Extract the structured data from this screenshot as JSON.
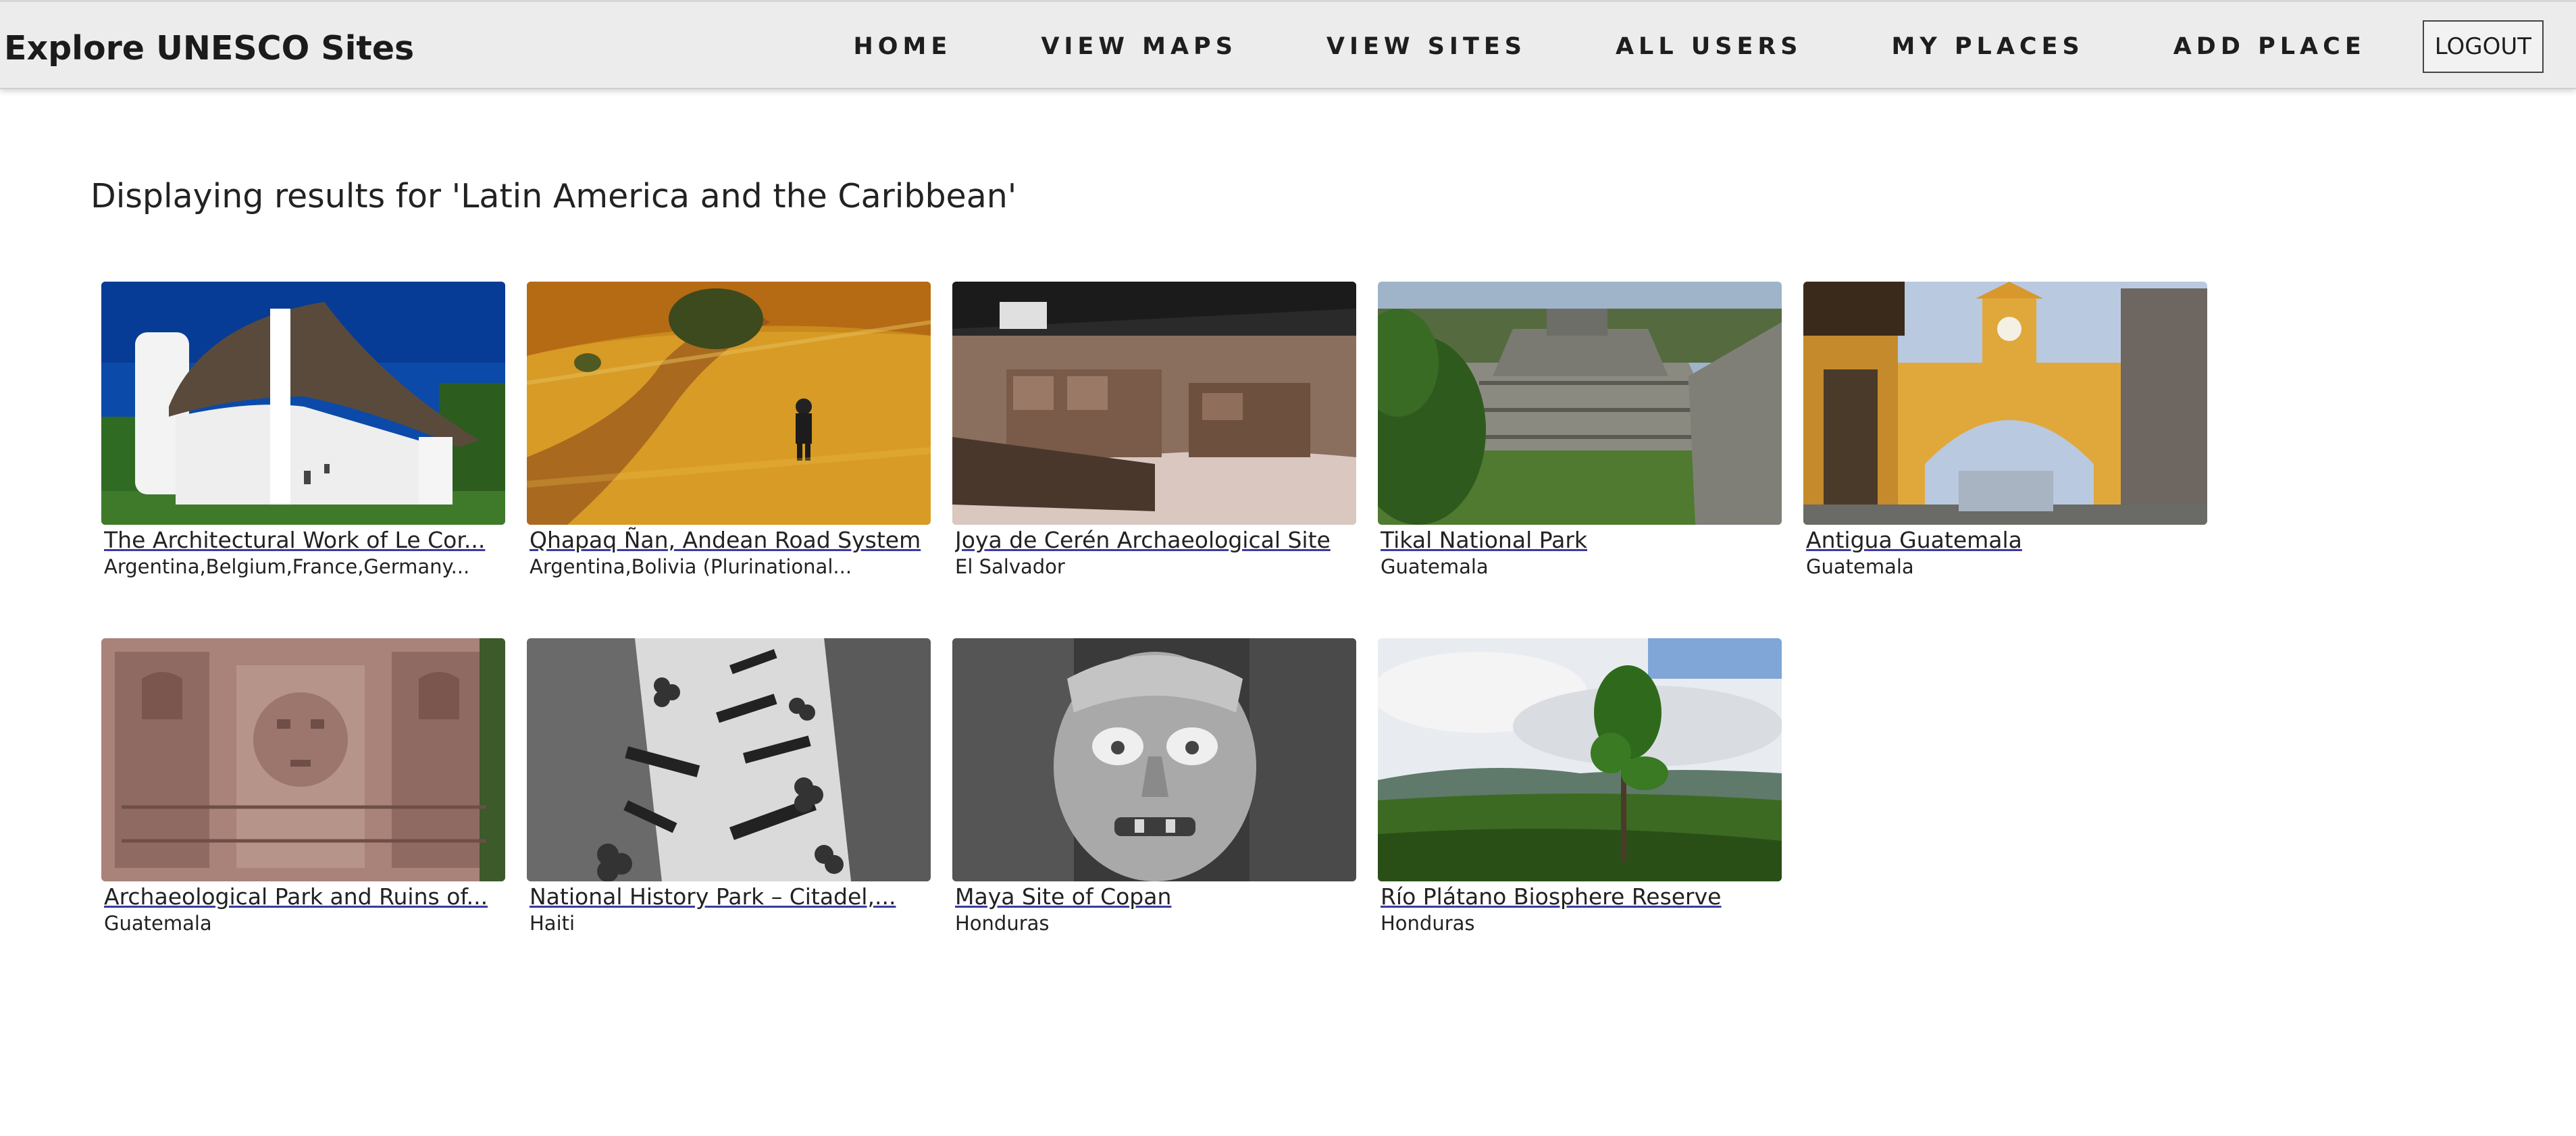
{
  "header": {
    "brand": "Explore UNESCO Sites",
    "nav": [
      "HOME",
      "VIEW MAPS",
      "VIEW SITES",
      "ALL USERS",
      "MY PLACES",
      "ADD PLACE"
    ],
    "logout_label": "LOGOUT"
  },
  "main": {
    "results_heading": "Displaying results for 'Latin America and the Caribbean'",
    "sites": [
      {
        "name": "The Architectural Work of Le Cor...",
        "countries": "Argentina,Belgium,France,Germany...",
        "image": "modernist-chapel-photo"
      },
      {
        "name": "Qhapaq Ñan, Andean Road System",
        "countries": "Argentina,Bolivia (Plurinational...",
        "image": "andean-hillside-trail-photo"
      },
      {
        "name": "Joya de Cerén Archaeological Site",
        "countries": "El Salvador",
        "image": "excavated-ruins-photo"
      },
      {
        "name": "Tikal National Park",
        "countries": "Guatemala",
        "image": "maya-temple-ruins-photo"
      },
      {
        "name": "Antigua Guatemala",
        "countries": "Guatemala",
        "image": "yellow-arch-street-photo"
      },
      {
        "name": "Archaeological Park and Ruins of...",
        "countries": "Guatemala",
        "image": "carved-stone-relief-photo"
      },
      {
        "name": "National History Park – Citadel,...",
        "countries": "Haiti",
        "image": "fortress-cannons-photo"
      },
      {
        "name": "Maya Site of Copan",
        "countries": "Honduras",
        "image": "stone-head-sculpture-photo"
      },
      {
        "name": "Río Plátano Biosphere Reserve",
        "countries": "Honduras",
        "image": "forest-landscape-photo"
      }
    ]
  }
}
